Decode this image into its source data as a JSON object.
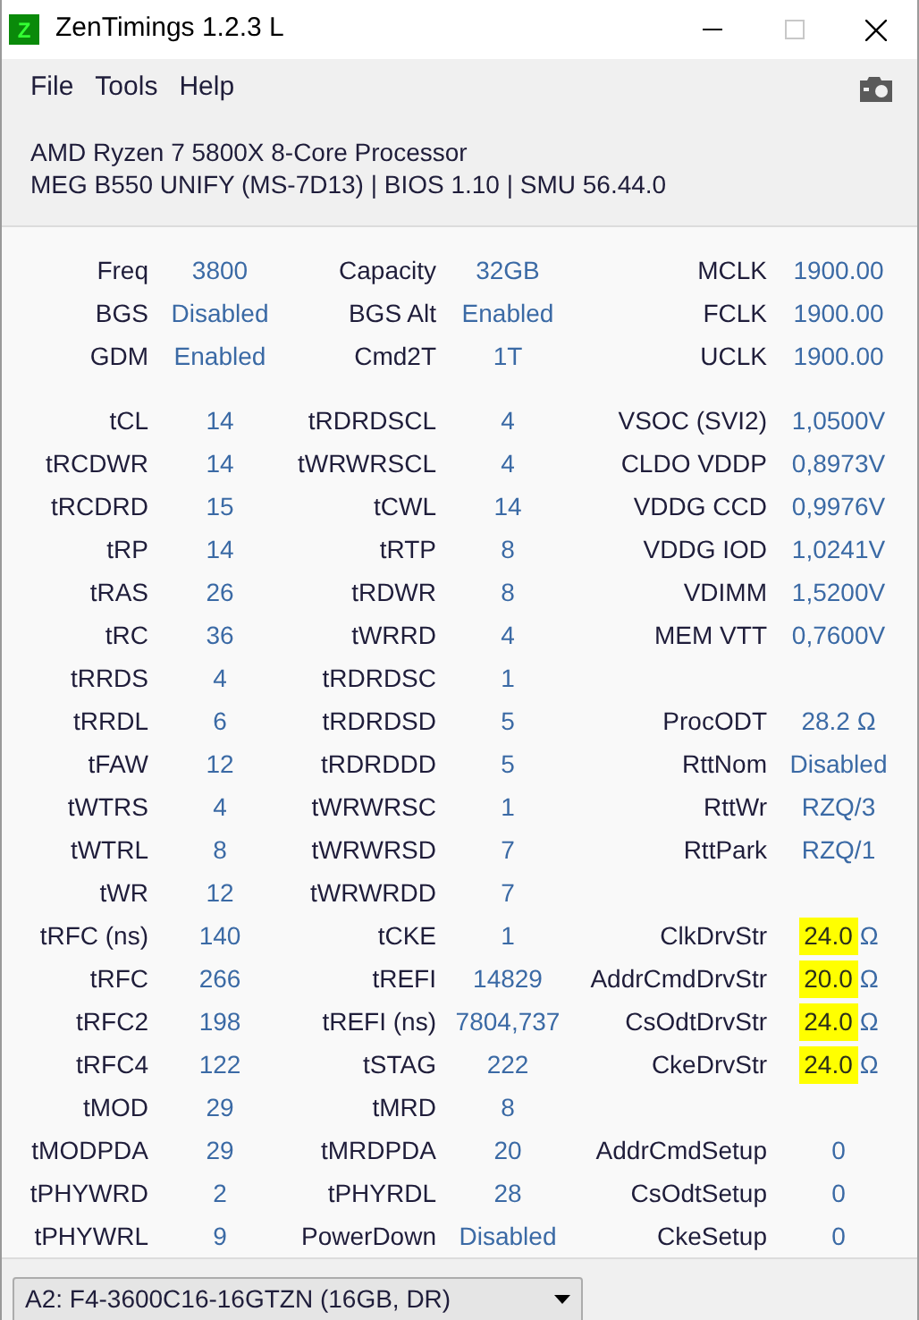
{
  "window": {
    "title": "ZenTimings 1.2.3 L",
    "app_icon": "Z"
  },
  "menu": [
    "File",
    "Tools",
    "Help"
  ],
  "info": [
    "AMD Ryzen 7 5800X 8-Core Processor",
    "MEG B550 UNIFY (MS-7D13) | BIOS 1.10 | SMU 56.44.0"
  ],
  "summary": [
    {
      "c1": {
        "label": "Freq",
        "value": "3800"
      },
      "c2": {
        "label": "Capacity",
        "value": "32GB"
      },
      "c3": {
        "label": "MCLK",
        "value": "1900.00",
        "highlighted": false
      }
    },
    {
      "c1": {
        "label": "BGS",
        "value": "Disabled"
      },
      "c2": {
        "label": "BGS Alt",
        "value": "Enabled"
      },
      "c3": {
        "label": "FCLK",
        "value": "1900.00",
        "highlighted": false
      }
    },
    {
      "c1": {
        "label": "GDM",
        "value": "Enabled"
      },
      "c2": {
        "label": "Cmd2T",
        "value": "1T"
      },
      "c3": {
        "label": "UCLK",
        "value": "1900.00",
        "highlighted": false
      }
    }
  ],
  "timings": [
    {
      "c1": {
        "label": "tCL",
        "value": "14"
      },
      "c2": {
        "label": "tRDRDSCL",
        "value": "4"
      },
      "c3": {
        "label": "VSOC (SVI2)",
        "value": "1,0500V",
        "highlighted": false
      }
    },
    {
      "c1": {
        "label": "tRCDWR",
        "value": "14"
      },
      "c2": {
        "label": "tWRWRSCL",
        "value": "4"
      },
      "c3": {
        "label": "CLDO VDDP",
        "value": "0,8973V",
        "highlighted": false
      }
    },
    {
      "c1": {
        "label": "tRCDRD",
        "value": "15"
      },
      "c2": {
        "label": "tCWL",
        "value": "14"
      },
      "c3": {
        "label": "VDDG CCD",
        "value": "0,9976V",
        "highlighted": false
      }
    },
    {
      "c1": {
        "label": "tRP",
        "value": "14"
      },
      "c2": {
        "label": "tRTP",
        "value": "8"
      },
      "c3": {
        "label": "VDDG IOD",
        "value": "1,0241V",
        "highlighted": false
      }
    },
    {
      "c1": {
        "label": "tRAS",
        "value": "26"
      },
      "c2": {
        "label": "tRDWR",
        "value": "8"
      },
      "c3": {
        "label": "VDIMM",
        "value": "1,5200V",
        "highlighted": false
      }
    },
    {
      "c1": {
        "label": "tRC",
        "value": "36"
      },
      "c2": {
        "label": "tWRRD",
        "value": "4"
      },
      "c3": {
        "label": "MEM VTT",
        "value": "0,7600V",
        "highlighted": false
      }
    },
    {
      "c1": {
        "label": "tRRDS",
        "value": "4"
      },
      "c2": {
        "label": "tRDRDSC",
        "value": "1"
      }
    },
    {
      "c1": {
        "label": "tRRDL",
        "value": "6"
      },
      "c2": {
        "label": "tRDRDSD",
        "value": "5"
      },
      "c3": {
        "label": "ProcODT",
        "value": "28.2 Ω",
        "highlighted": false
      }
    },
    {
      "c1": {
        "label": "tFAW",
        "value": "12"
      },
      "c2": {
        "label": "tRDRDDD",
        "value": "5"
      },
      "c3": {
        "label": "RttNom",
        "value": "Disabled",
        "highlighted": false
      }
    },
    {
      "c1": {
        "label": "tWTRS",
        "value": "4"
      },
      "c2": {
        "label": "tWRWRSC",
        "value": "1"
      },
      "c3": {
        "label": "RttWr",
        "value": "RZQ/3",
        "highlighted": false
      }
    },
    {
      "c1": {
        "label": "tWTRL",
        "value": "8"
      },
      "c2": {
        "label": "tWRWRSD",
        "value": "7"
      },
      "c3": {
        "label": "RttPark",
        "value": "RZQ/1",
        "highlighted": false
      }
    },
    {
      "c1": {
        "label": "tWR",
        "value": "12"
      },
      "c2": {
        "label": "tWRWRDD",
        "value": "7"
      }
    },
    {
      "c1": {
        "label": "tRFC (ns)",
        "value": "140"
      },
      "c2": {
        "label": "tCKE",
        "value": "1"
      },
      "c3": {
        "label": "ClkDrvStr",
        "value": "24.0",
        "unit": "Ω",
        "highlighted": true
      }
    },
    {
      "c1": {
        "label": "tRFC",
        "value": "266"
      },
      "c2": {
        "label": "tREFI",
        "value": "14829"
      },
      "c3": {
        "label": "AddrCmdDrvStr",
        "value": "20.0",
        "unit": "Ω",
        "highlighted": true
      }
    },
    {
      "c1": {
        "label": "tRFC2",
        "value": "198"
      },
      "c2": {
        "label": "tREFI (ns)",
        "value": "7804,737"
      },
      "c3": {
        "label": "CsOdtDrvStr",
        "value": "24.0",
        "unit": "Ω",
        "highlighted": true
      }
    },
    {
      "c1": {
        "label": "tRFC4",
        "value": "122"
      },
      "c2": {
        "label": "tSTAG",
        "value": "222"
      },
      "c3": {
        "label": "CkeDrvStr",
        "value": "24.0",
        "unit": "Ω",
        "highlighted": true
      }
    },
    {
      "c1": {
        "label": "tMOD",
        "value": "29"
      },
      "c2": {
        "label": "tMRD",
        "value": "8"
      }
    },
    {
      "c1": {
        "label": "tMODPDA",
        "value": "29"
      },
      "c2": {
        "label": "tMRDPDA",
        "value": "20"
      },
      "c3": {
        "label": "AddrCmdSetup",
        "value": "0",
        "highlighted": false
      }
    },
    {
      "c1": {
        "label": "tPHYWRD",
        "value": "2"
      },
      "c2": {
        "label": "tPHYRDL",
        "value": "28"
      },
      "c3": {
        "label": "CsOdtSetup",
        "value": "0",
        "highlighted": false
      }
    },
    {
      "c1": {
        "label": "tPHYWRL",
        "value": "9"
      },
      "c2": {
        "label": "PowerDown",
        "value": "Disabled"
      },
      "c3": {
        "label": "CkeSetup",
        "value": "0",
        "highlighted": false
      }
    }
  ],
  "module_select": {
    "value": "A2: F4-3600C16-16GTZN (16GB, DR)"
  }
}
